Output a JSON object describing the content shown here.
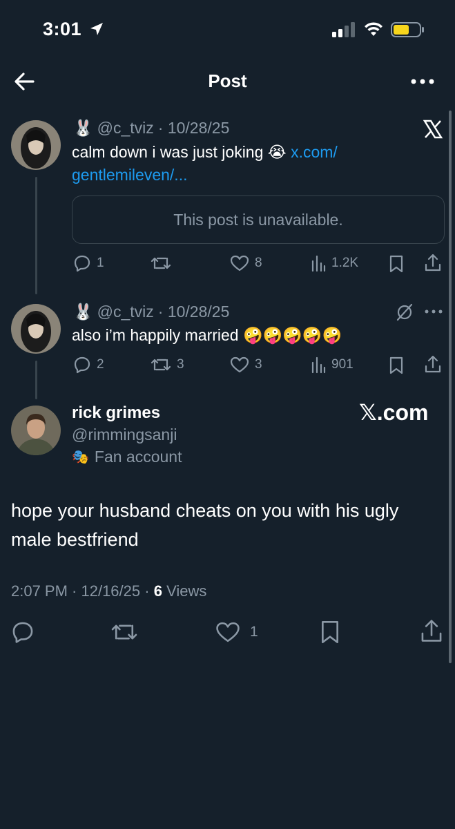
{
  "status_bar": {
    "time": "3:01"
  },
  "header": {
    "title": "Post"
  },
  "tweets": [
    {
      "emoji": "🐰",
      "handle": "@c_tviz",
      "date": "· 10/28/25",
      "text": "calm down i was just joking 😭",
      "link": "x.com/",
      "link2": "gentlemileven/...",
      "quote_unavailable": "This post is unavailable.",
      "stats": {
        "replies": "1",
        "reposts": "",
        "likes": "8",
        "views": "1.2K"
      }
    },
    {
      "emoji": "🐰",
      "handle": "@c_tviz",
      "date": "· 10/28/25",
      "text": "also i’m happily married 🤪🤪🤪🤪🤪",
      "stats": {
        "replies": "2",
        "reposts": "3",
        "likes": "3",
        "views": "901"
      }
    }
  ],
  "main_post": {
    "name": "rick grimes",
    "handle": "@rimmingsanji",
    "badge_emoji": "🎭",
    "badge": "Fan account",
    "brand": "𝕏.com",
    "text": "hope your husband cheats on you with his ugly male bestfriend",
    "time": "2:07 PM · 12/16/25 ·",
    "views_count": "6",
    "views_label": "Views",
    "likes": "1"
  },
  "colors": {
    "background": "#15202b",
    "muted": "#8b98a5",
    "link": "#1d9bf0",
    "divider": "#38444d"
  }
}
